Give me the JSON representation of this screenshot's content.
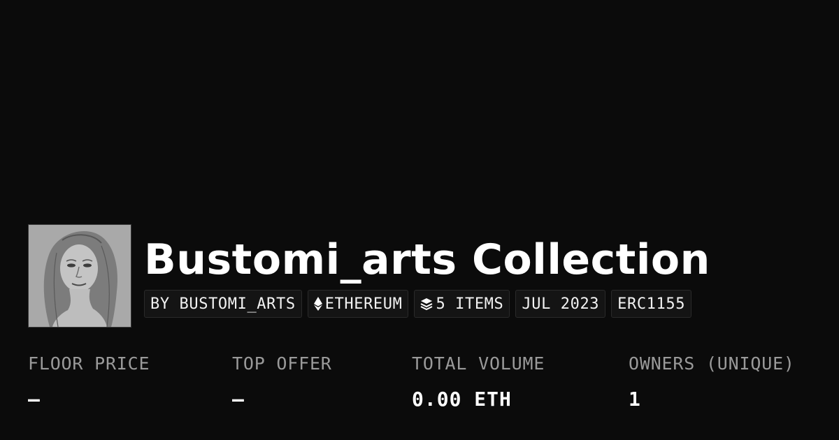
{
  "collection": {
    "title": "Bustomi_arts Collection"
  },
  "tags": {
    "creator": "BY BUSTOMI_ARTS",
    "chain": "ETHEREUM",
    "items": "5 ITEMS",
    "date": "JUL 2023",
    "standard": "ERC1155",
    "chain_icon": "ethereum-icon",
    "items_icon": "layers-icon"
  },
  "stats": {
    "floor_price": {
      "label": "FLOOR PRICE",
      "value": "–"
    },
    "top_offer": {
      "label": "TOP OFFER",
      "value": "–"
    },
    "total_volume": {
      "label": "TOTAL VOLUME",
      "value": "0.00 ETH"
    },
    "owners": {
      "label": "OWNERS (UNIQUE)",
      "value": "1"
    }
  },
  "colors": {
    "background": "#0b0b0b",
    "tag_background": "#141414",
    "label_gray": "#9a9a9a",
    "text_white": "#ffffff"
  }
}
